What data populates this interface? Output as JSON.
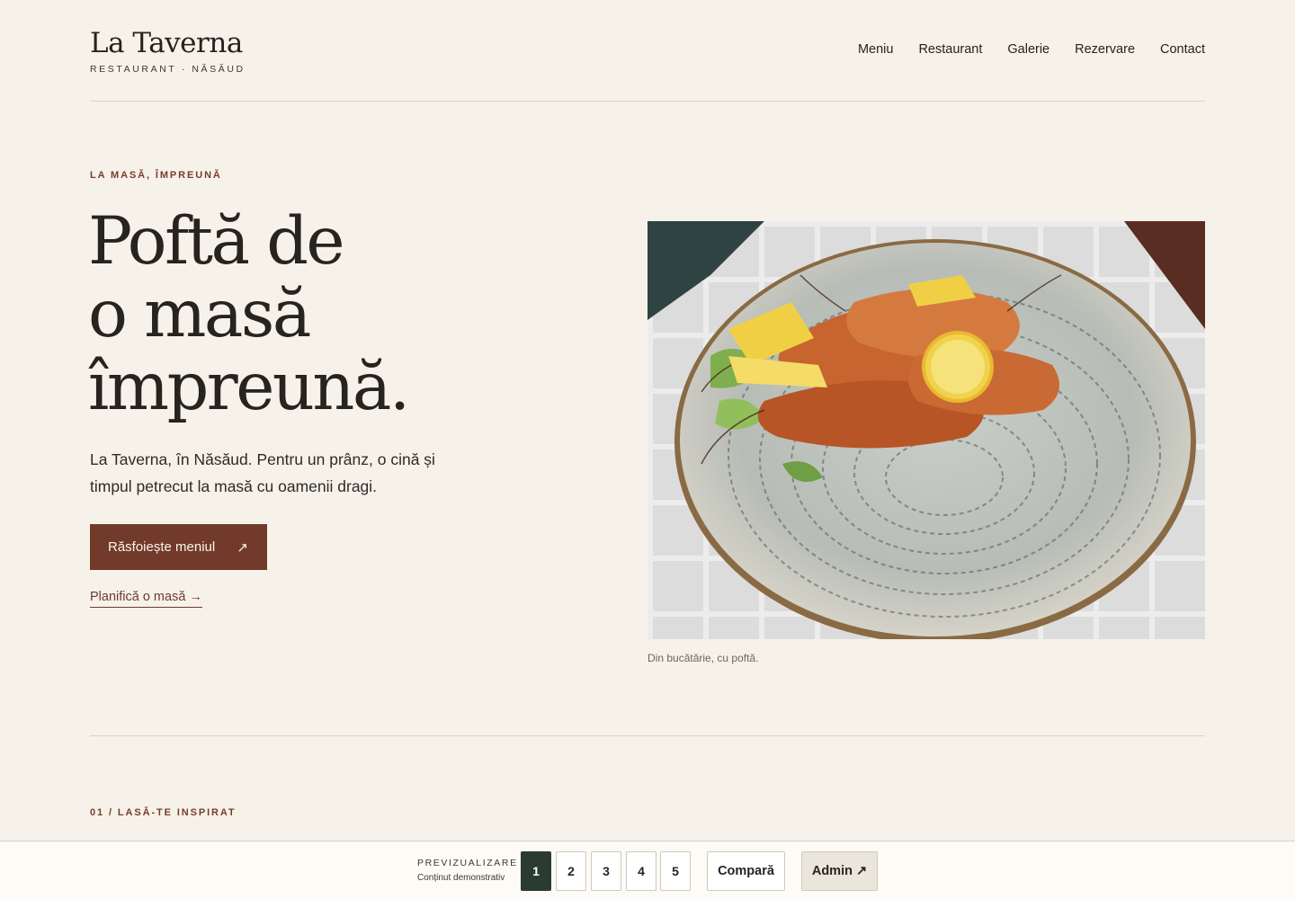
{
  "brand": {
    "name": "La Taverna",
    "subtitle": "RESTAURANT · NĂSĂUD"
  },
  "nav": {
    "items": [
      {
        "label": "Meniu"
      },
      {
        "label": "Restaurant"
      },
      {
        "label": "Galerie"
      },
      {
        "label": "Rezervare"
      },
      {
        "label": "Contact"
      }
    ]
  },
  "hero": {
    "eyebrow": "LA MASĂ, ÎMPREUNĂ",
    "title_lines": [
      "Poftă de",
      "o masă",
      "împreună."
    ],
    "text": "La Taverna, în Năsăud. Pentru un prânz, o cină și timpul petrecut la masă cu oamenii dragi.",
    "cta_label": "Răsfoiește meniul",
    "cta_icon": "↗",
    "secondary_link": "Planifică o masă →",
    "photo_caption": "Din bucătărie, cu poftă."
  },
  "section": {
    "label": "01 / LASĂ-TE INSPIRAT"
  },
  "preview_bar": {
    "label": "PREVIZUALIZARE",
    "sublabel": "Conținut demonstrativ",
    "pages": [
      "1",
      "2",
      "3",
      "4",
      "5"
    ],
    "active_page": "1",
    "compare_label": "Compară",
    "admin_label": "Admin ↗"
  },
  "colors": {
    "background": "#f6f2ea",
    "accent": "#723a2b",
    "active_page": "#2b3a33"
  }
}
